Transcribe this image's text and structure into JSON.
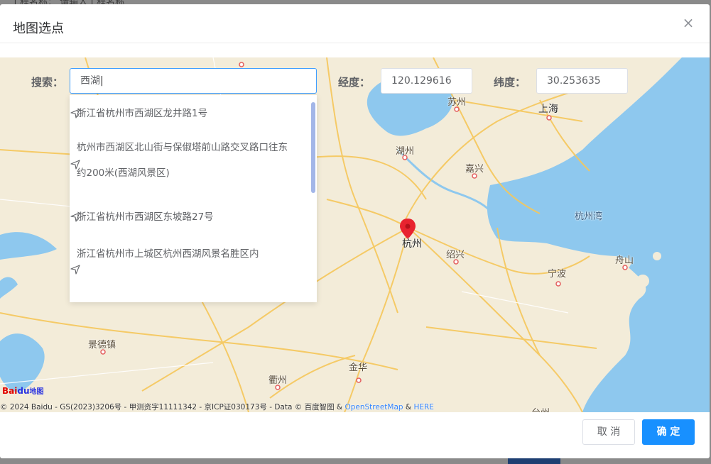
{
  "background": {
    "field_text": "工程名称：  请输入工程名称"
  },
  "dialog": {
    "title": "地图选点",
    "close_glyph": "×"
  },
  "search": {
    "label": "搜索：",
    "value": "西湖",
    "longitude_label": "经度：",
    "longitude_value": "120.129616",
    "latitude_label": "纬度：",
    "latitude_value": "30.253635"
  },
  "suggestions": [
    {
      "text": "浙江省杭州市西湖区龙井路1号"
    },
    {
      "text": "杭州市西湖区北山街与保俶塔前山路交叉路口往东约200米(西湖风景区)"
    },
    {
      "text": "浙江省杭州市西湖区东坡路27号"
    },
    {
      "text": "浙江省杭州市上城区杭州西湖风景名胜区内"
    }
  ],
  "map": {
    "cities": {
      "suzhou": "苏州",
      "shanghai": "上海",
      "huzhou": "湖州",
      "jiaxing": "嘉兴",
      "hangzhou": "杭州",
      "hangzhouwan": "杭州湾",
      "shaoxing": "绍兴",
      "zhoushan": "舟山",
      "ningbo": "宁波",
      "jingdezhen": "景德镇",
      "jinhua": "金华",
      "quzhou": "衢州",
      "taizhou": "台州"
    },
    "logo_text_a": "Bai",
    "logo_text_b": "du",
    "logo_text_c": "地图",
    "copyright": "© 2024 Baidu - GS(2023)3206号 - 甲测资字11111342 - 京ICP证030173号 - Data © 百度智图 & ",
    "copyright_link1": "OpenStreetMap",
    "copyright_amp": " & ",
    "copyright_link2": "HERE"
  },
  "footer": {
    "cancel_label": "取 消",
    "ok_label": "确 定"
  },
  "colors": {
    "primary": "#1890ff",
    "sea": "#8ec8ee",
    "land": "#f3ecd9",
    "road": "#f6c75a",
    "marker": "#e8232f"
  }
}
